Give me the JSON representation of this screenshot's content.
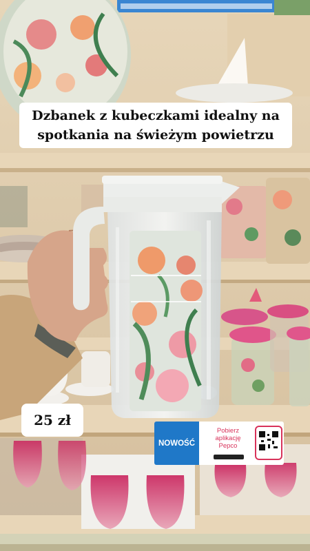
{
  "overlay": {
    "caption": "Dzbanek z kubeczkami idealny na spotkania na świeżym powietrzu",
    "price": "25 zł"
  },
  "shelf_tag": {
    "badge": "NOWOŚĆ",
    "message": "Pobierz aplikację Pepco"
  },
  "colors": {
    "caption_bg": "#ffffff",
    "tag_badge": "#1f78c8",
    "tag_text": "#d8325a",
    "shelf": "#e8d6b8"
  }
}
